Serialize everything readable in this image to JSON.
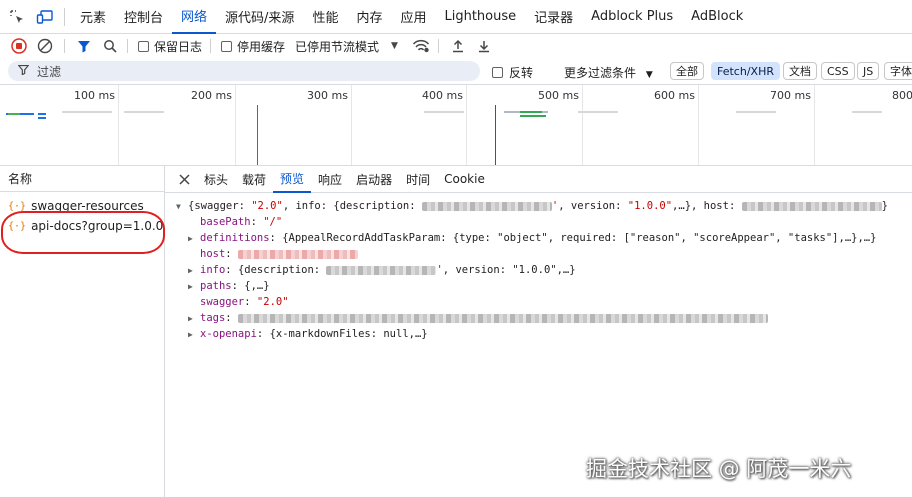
{
  "panel_tabs": [
    "元素",
    "控制台",
    "网络",
    "源代码/来源",
    "性能",
    "内存",
    "应用",
    "Lighthouse",
    "记录器",
    "Adblock Plus",
    "AdBlock"
  ],
  "toolbar": {
    "preserve_log": "保留日志",
    "disable_cache": "停用缓存",
    "throttling": "已停用节流模式"
  },
  "filter": {
    "placeholder": "过滤",
    "invert": "反转",
    "more_filters": "更多过滤条件",
    "types": [
      "全部",
      "Fetch/XHR",
      "文档",
      "CSS",
      "JS",
      "字体"
    ],
    "active_type": "Fetch/XHR"
  },
  "overview": {
    "ticks": [
      "100 ms",
      "200 ms",
      "300 ms",
      "400 ms",
      "500 ms",
      "600 ms",
      "700 ms",
      "800"
    ]
  },
  "requests": {
    "header": "名称",
    "items": [
      "swagger-resources",
      "api-docs?group=1.0.0"
    ],
    "highlighted_index": 1
  },
  "detail_tabs": [
    "标头",
    "载荷",
    "预览",
    "响应",
    "启动器",
    "时间",
    "Cookie"
  ],
  "active_detail_tab": "预览",
  "preview": {
    "root_open": "{swagger: ",
    "root_swagger": "\"2.0\"",
    "root_info": ", info: {description: ",
    "root_version": ", version: ",
    "root_version_val": "\"1.0.0\"",
    "root_tail1": ",…}, host: ",
    "root_close": "}",
    "basePath_key": "basePath",
    "basePath_val": "\"/\"",
    "definitions_key": "definitions",
    "definitions_val": "{AppealRecordAddTaskParam: {type: \"object\", required: [\"reason\", \"scoreAppear\", \"tasks\"],…},…}",
    "host_key": "host",
    "info_key": "info",
    "info_val_a": "{description: ",
    "info_val_b": ", version: \"1.0.0\",…}",
    "paths_key": "paths",
    "paths_val": "{,…}",
    "swagger_key": "swagger",
    "swagger_val": "\"2.0\"",
    "tags_key": "tags",
    "xopenapi_key": "x-openapi",
    "xopenapi_val": "{x-markdownFiles: null,…}"
  },
  "watermark": "掘金技术社区 @ 阿茂一米六",
  "colors": {
    "accent": "#0b57d0",
    "highlight_circle": "#e02020",
    "property_key": "#881280",
    "string_value": "#c80000"
  }
}
